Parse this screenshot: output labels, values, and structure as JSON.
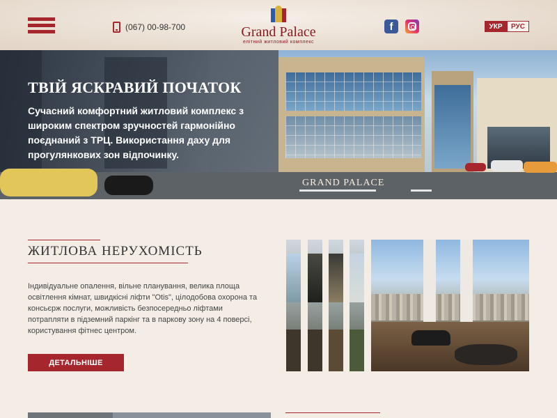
{
  "header": {
    "phone": "(067) 00-98-700",
    "logo_name": "Grand Palace",
    "logo_sub": "елітний житловий комплекс",
    "social": [
      {
        "name": "facebook",
        "glyph": "f"
      },
      {
        "name": "instagram",
        "glyph": ""
      }
    ],
    "languages": [
      {
        "label": "УКР",
        "active": true
      },
      {
        "label": "РУС",
        "active": false
      }
    ],
    "menu_icon": "hamburger-icon",
    "phone_icon": "mobile-phone-icon"
  },
  "hero": {
    "title": "ТВІЙ ЯСКРАВИЙ ПОЧАТОК",
    "text": "Сучасний комфортний житловий комплекс з широким спектром зручностей гармонійно поєднаний з ТРЦ. Використання даху для прогулянкових зон відпочинку.",
    "building_sign": "GRAND PALACE"
  },
  "section": {
    "title": "ЖИТЛОВА НЕРУХОМІСТЬ",
    "text": "Індивідуальне опалення, вільне планування, велика площа освітлення кімнат, швидкісні ліфти \"Otis\", цілодобова охорона та консьєрж послуги, можливість безпосередньо ліфтами потрапляти в підземний паркінг та в паркову зону на 4 поверсі, користування фітнес центром.",
    "button": "ДЕТАЛЬНІШЕ"
  },
  "colors": {
    "accent": "#a5262c",
    "background": "#f3ede6"
  }
}
